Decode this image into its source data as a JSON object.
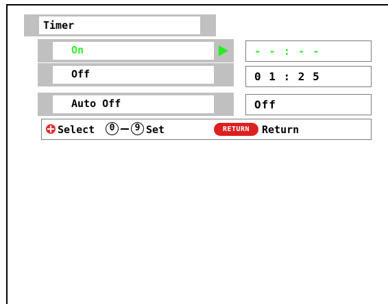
{
  "title": "Timer",
  "rows": [
    {
      "label": "On",
      "value": "- - : - -",
      "selected": true
    },
    {
      "label": "Off",
      "value": "0 1 : 2 5",
      "selected": false
    },
    {
      "label": "Auto Off",
      "value": "Off",
      "selected": false
    }
  ],
  "help": {
    "select_label": "Select",
    "digit_from": "0",
    "digit_to": "9",
    "set_label": "Set",
    "return_button": "RETURN",
    "return_label": "Return"
  },
  "colors": {
    "highlight": "#33ee33",
    "panel_gray": "#c0c0c0",
    "return_red": "#dd2020"
  }
}
